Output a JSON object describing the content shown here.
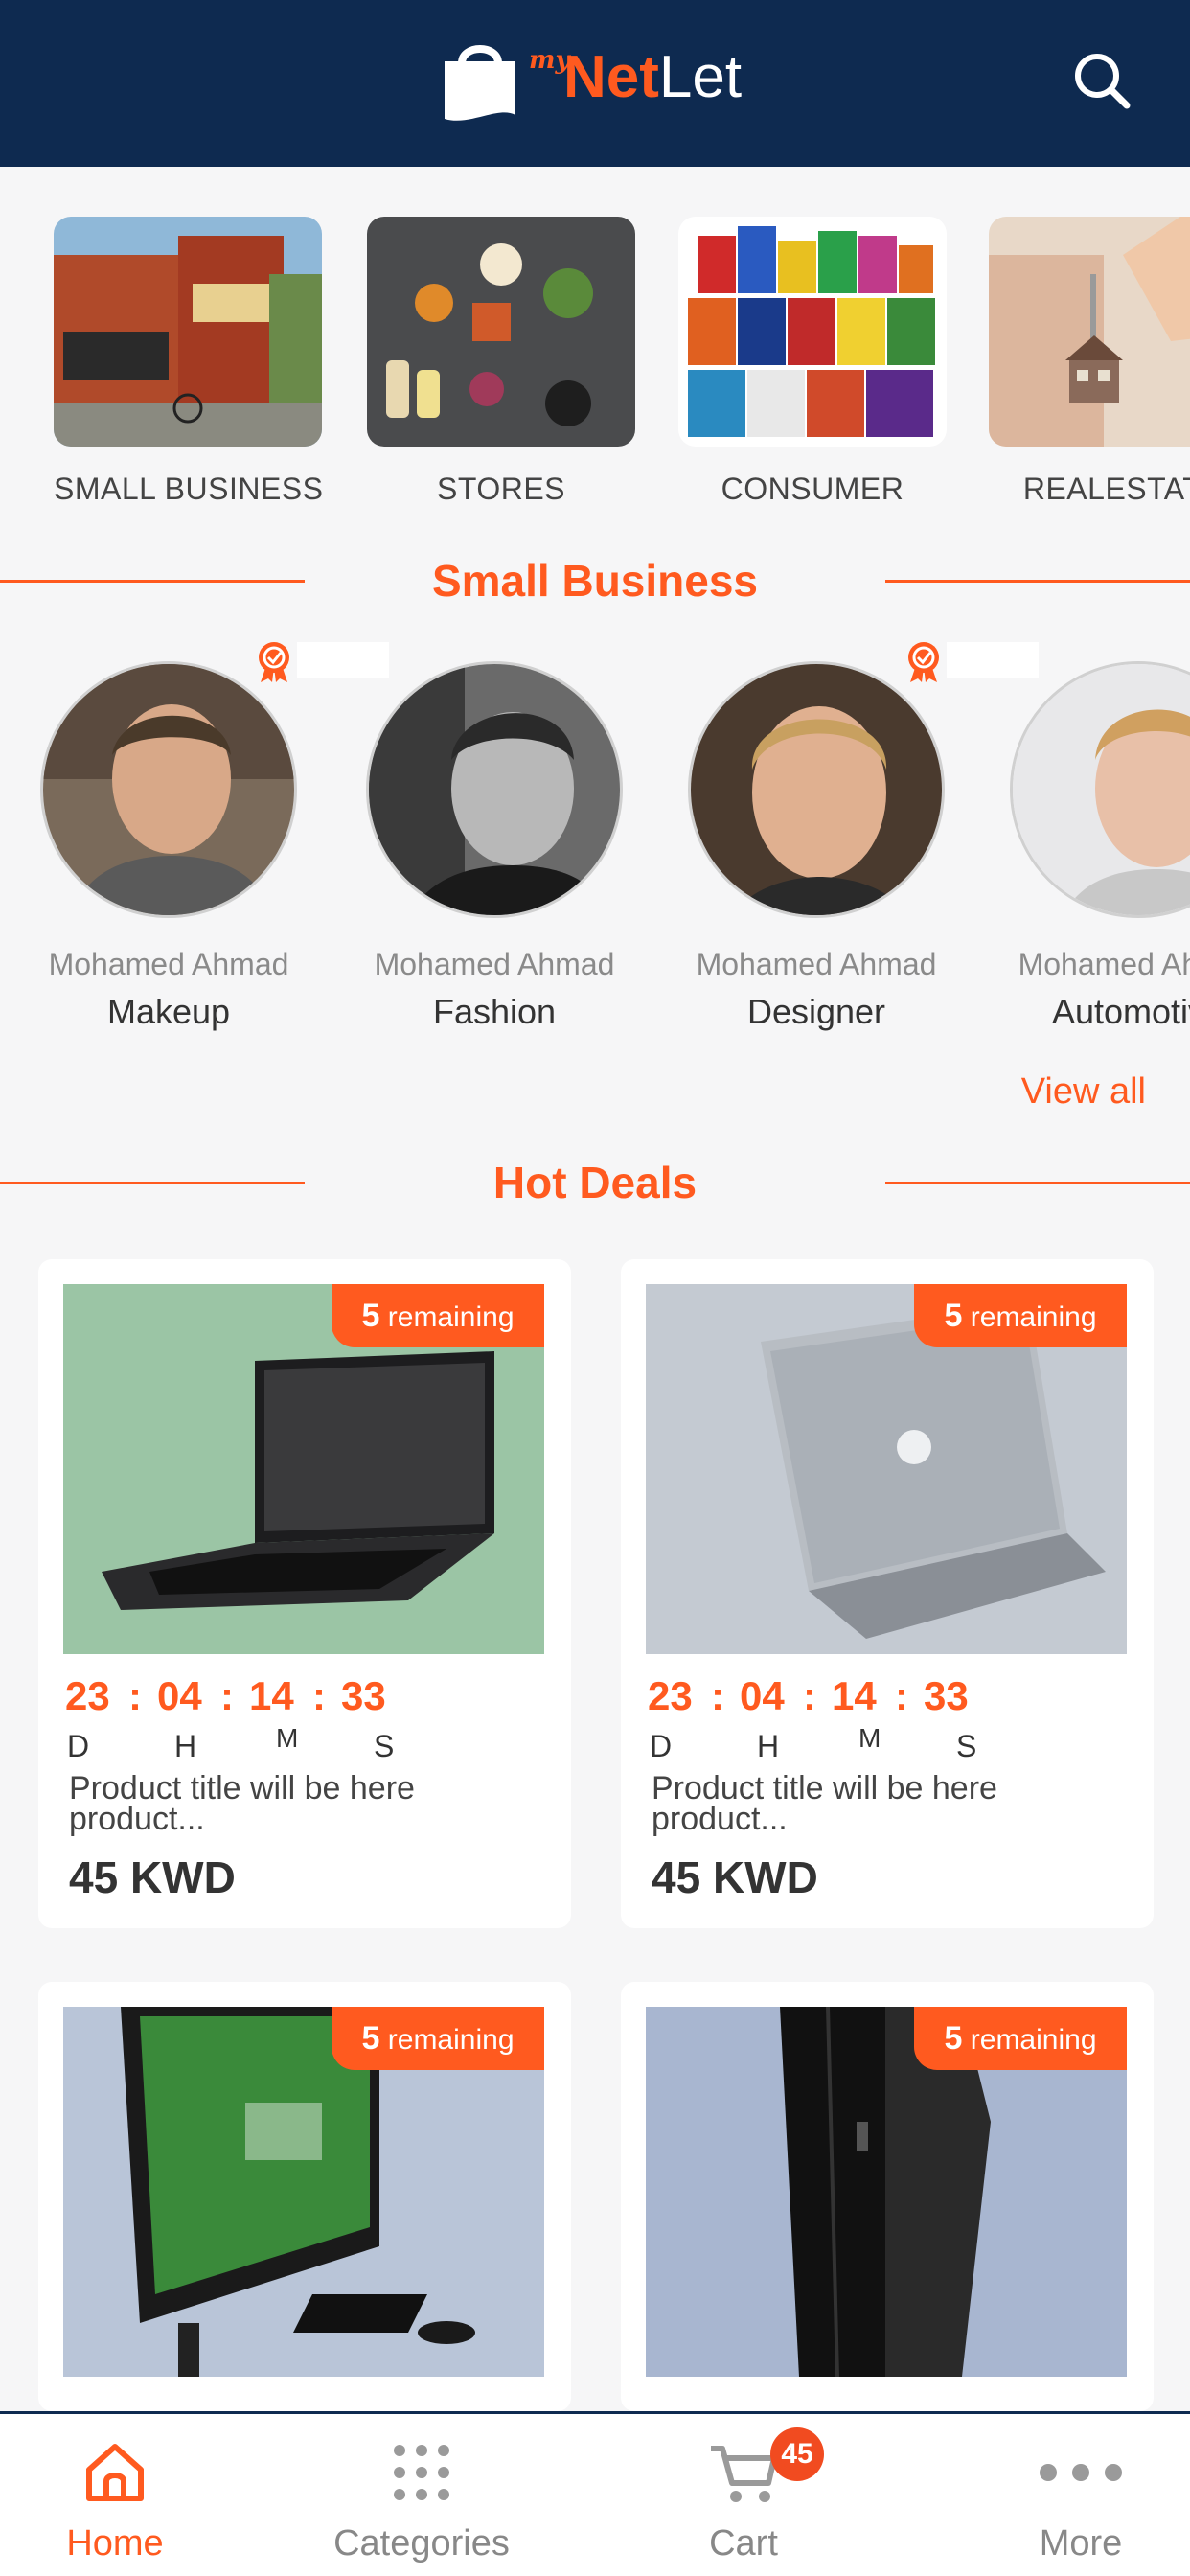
{
  "header": {
    "logo_prefix": "my",
    "logo_net": "Net",
    "logo_let": "Let",
    "search_icon": "search-icon"
  },
  "categories": [
    {
      "label": "SMALL BUSINESS"
    },
    {
      "label": "STORES"
    },
    {
      "label": "CONSUMER"
    },
    {
      "label": "REALESTATE"
    }
  ],
  "small_business": {
    "title": "Small Business",
    "people": [
      {
        "name": "Mohamed Ahmad",
        "role": "Makeup",
        "verified": true
      },
      {
        "name": "Mohamed Ahmad",
        "role": "Fashion",
        "verified": false
      },
      {
        "name": "Mohamed Ahmad",
        "role": "Designer",
        "verified": true
      },
      {
        "name": "Mohamed Ahmad",
        "role": "Automotive",
        "verified": false
      }
    ],
    "view_all": "View all"
  },
  "hot_deals": {
    "title": "Hot Deals",
    "units": {
      "d": "D",
      "h": "H",
      "m": "M",
      "s": "S"
    },
    "deals": [
      {
        "remaining_num": "5",
        "remaining_text": "remaining",
        "days": "23",
        "hours": "04",
        "minutes": "14",
        "seconds": "33",
        "title": "Product title will be here product...",
        "price": "45 KWD"
      },
      {
        "remaining_num": "5",
        "remaining_text": "remaining",
        "days": "23",
        "hours": "04",
        "minutes": "14",
        "seconds": "33",
        "title": "Product title will be here product...",
        "price": "45 KWD"
      },
      {
        "remaining_num": "5",
        "remaining_text": "remaining"
      },
      {
        "remaining_num": "5",
        "remaining_text": "remaining"
      }
    ]
  },
  "bottom_nav": {
    "home": "Home",
    "categories": "Categories",
    "cart": "Cart",
    "cart_count": "45",
    "more": "More"
  },
  "colors": {
    "header_bg": "#0e2a50",
    "accent": "#ff5a1f",
    "page_bg": "#f6f6f7"
  }
}
